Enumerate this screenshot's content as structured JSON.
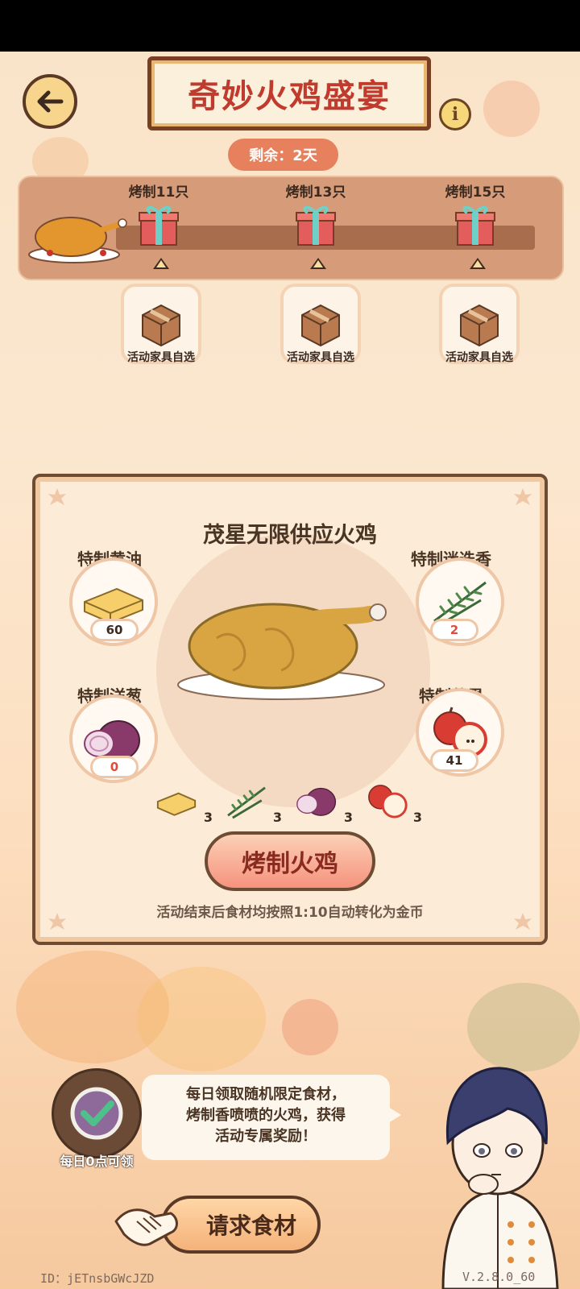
{
  "header": {
    "title": "奇妙火鸡盛宴",
    "info": "i",
    "remaining": "剩余：2天"
  },
  "milestones": [
    {
      "label": "烤制11只",
      "reward_label": "活动家具自选"
    },
    {
      "label": "烤制13只",
      "reward_label": "活动家具自选"
    },
    {
      "label": "烤制15只",
      "reward_label": "活动家具自选"
    }
  ],
  "panel": {
    "title": "茂星无限供应火鸡",
    "ingredients": [
      {
        "name": "特制黄油",
        "count": "60",
        "count_color": "#3c2a20"
      },
      {
        "name": "特制迷迭香",
        "count": "2",
        "count_color": "#e14b3b"
      },
      {
        "name": "特制洋葱",
        "count": "0",
        "count_color": "#e14b3b"
      },
      {
        "name": "特制苹果",
        "count": "41",
        "count_color": "#3c2a20"
      }
    ],
    "costs": [
      "3",
      "3",
      "3",
      "3"
    ],
    "roast_button": "烤制火鸡",
    "footer_note": "活动结束后食材均按照1:10自动转化为金币"
  },
  "daily": {
    "label": "每日0点可领",
    "bubble": [
      "每日领取随机限定食材，",
      "烤制香喷喷的火鸡，获得",
      "活动专属奖励！"
    ],
    "request_button": "请求食材"
  },
  "footer": {
    "id": "ID：jETnsbGWcJZD",
    "version": "V.2.8.0_60"
  }
}
